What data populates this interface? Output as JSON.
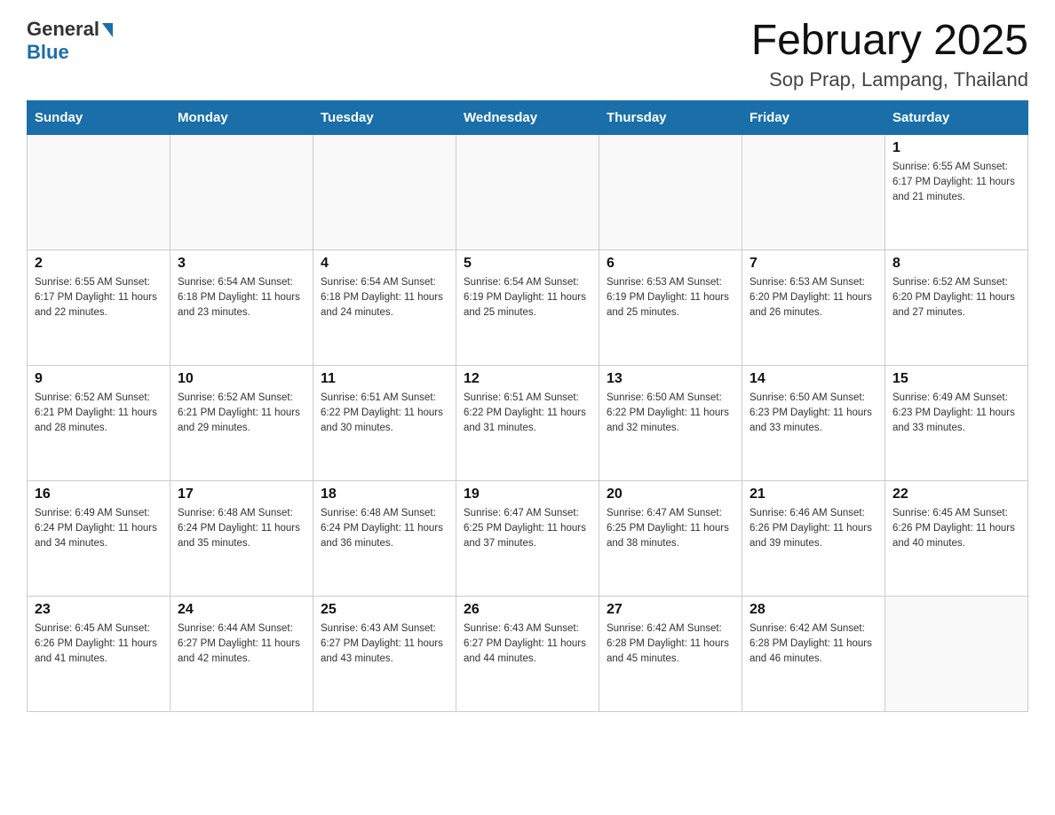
{
  "header": {
    "logo_general": "General",
    "logo_blue": "Blue",
    "title": "February 2025",
    "subtitle": "Sop Prap, Lampang, Thailand"
  },
  "weekdays": [
    "Sunday",
    "Monday",
    "Tuesday",
    "Wednesday",
    "Thursday",
    "Friday",
    "Saturday"
  ],
  "weeks": [
    [
      {
        "day": "",
        "info": ""
      },
      {
        "day": "",
        "info": ""
      },
      {
        "day": "",
        "info": ""
      },
      {
        "day": "",
        "info": ""
      },
      {
        "day": "",
        "info": ""
      },
      {
        "day": "",
        "info": ""
      },
      {
        "day": "1",
        "info": "Sunrise: 6:55 AM\nSunset: 6:17 PM\nDaylight: 11 hours\nand 21 minutes."
      }
    ],
    [
      {
        "day": "2",
        "info": "Sunrise: 6:55 AM\nSunset: 6:17 PM\nDaylight: 11 hours\nand 22 minutes."
      },
      {
        "day": "3",
        "info": "Sunrise: 6:54 AM\nSunset: 6:18 PM\nDaylight: 11 hours\nand 23 minutes."
      },
      {
        "day": "4",
        "info": "Sunrise: 6:54 AM\nSunset: 6:18 PM\nDaylight: 11 hours\nand 24 minutes."
      },
      {
        "day": "5",
        "info": "Sunrise: 6:54 AM\nSunset: 6:19 PM\nDaylight: 11 hours\nand 25 minutes."
      },
      {
        "day": "6",
        "info": "Sunrise: 6:53 AM\nSunset: 6:19 PM\nDaylight: 11 hours\nand 25 minutes."
      },
      {
        "day": "7",
        "info": "Sunrise: 6:53 AM\nSunset: 6:20 PM\nDaylight: 11 hours\nand 26 minutes."
      },
      {
        "day": "8",
        "info": "Sunrise: 6:52 AM\nSunset: 6:20 PM\nDaylight: 11 hours\nand 27 minutes."
      }
    ],
    [
      {
        "day": "9",
        "info": "Sunrise: 6:52 AM\nSunset: 6:21 PM\nDaylight: 11 hours\nand 28 minutes."
      },
      {
        "day": "10",
        "info": "Sunrise: 6:52 AM\nSunset: 6:21 PM\nDaylight: 11 hours\nand 29 minutes."
      },
      {
        "day": "11",
        "info": "Sunrise: 6:51 AM\nSunset: 6:22 PM\nDaylight: 11 hours\nand 30 minutes."
      },
      {
        "day": "12",
        "info": "Sunrise: 6:51 AM\nSunset: 6:22 PM\nDaylight: 11 hours\nand 31 minutes."
      },
      {
        "day": "13",
        "info": "Sunrise: 6:50 AM\nSunset: 6:22 PM\nDaylight: 11 hours\nand 32 minutes."
      },
      {
        "day": "14",
        "info": "Sunrise: 6:50 AM\nSunset: 6:23 PM\nDaylight: 11 hours\nand 33 minutes."
      },
      {
        "day": "15",
        "info": "Sunrise: 6:49 AM\nSunset: 6:23 PM\nDaylight: 11 hours\nand 33 minutes."
      }
    ],
    [
      {
        "day": "16",
        "info": "Sunrise: 6:49 AM\nSunset: 6:24 PM\nDaylight: 11 hours\nand 34 minutes."
      },
      {
        "day": "17",
        "info": "Sunrise: 6:48 AM\nSunset: 6:24 PM\nDaylight: 11 hours\nand 35 minutes."
      },
      {
        "day": "18",
        "info": "Sunrise: 6:48 AM\nSunset: 6:24 PM\nDaylight: 11 hours\nand 36 minutes."
      },
      {
        "day": "19",
        "info": "Sunrise: 6:47 AM\nSunset: 6:25 PM\nDaylight: 11 hours\nand 37 minutes."
      },
      {
        "day": "20",
        "info": "Sunrise: 6:47 AM\nSunset: 6:25 PM\nDaylight: 11 hours\nand 38 minutes."
      },
      {
        "day": "21",
        "info": "Sunrise: 6:46 AM\nSunset: 6:26 PM\nDaylight: 11 hours\nand 39 minutes."
      },
      {
        "day": "22",
        "info": "Sunrise: 6:45 AM\nSunset: 6:26 PM\nDaylight: 11 hours\nand 40 minutes."
      }
    ],
    [
      {
        "day": "23",
        "info": "Sunrise: 6:45 AM\nSunset: 6:26 PM\nDaylight: 11 hours\nand 41 minutes."
      },
      {
        "day": "24",
        "info": "Sunrise: 6:44 AM\nSunset: 6:27 PM\nDaylight: 11 hours\nand 42 minutes."
      },
      {
        "day": "25",
        "info": "Sunrise: 6:43 AM\nSunset: 6:27 PM\nDaylight: 11 hours\nand 43 minutes."
      },
      {
        "day": "26",
        "info": "Sunrise: 6:43 AM\nSunset: 6:27 PM\nDaylight: 11 hours\nand 44 minutes."
      },
      {
        "day": "27",
        "info": "Sunrise: 6:42 AM\nSunset: 6:28 PM\nDaylight: 11 hours\nand 45 minutes."
      },
      {
        "day": "28",
        "info": "Sunrise: 6:42 AM\nSunset: 6:28 PM\nDaylight: 11 hours\nand 46 minutes."
      },
      {
        "day": "",
        "info": ""
      }
    ]
  ]
}
